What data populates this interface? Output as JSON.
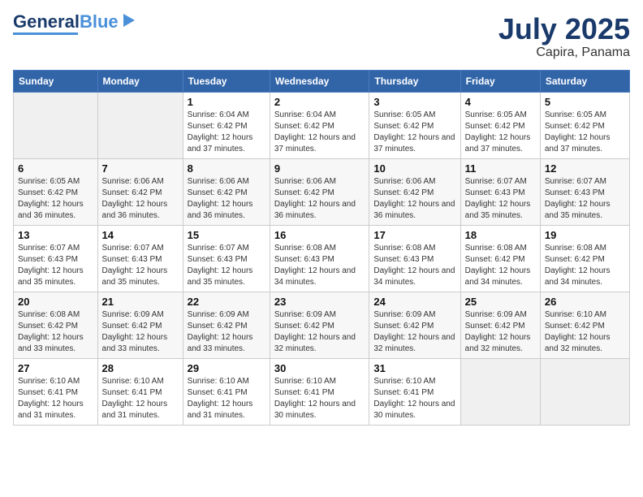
{
  "header": {
    "logo_main": "General",
    "logo_accent": "Blue",
    "month": "July 2025",
    "location": "Capira, Panama"
  },
  "days_of_week": [
    "Sunday",
    "Monday",
    "Tuesday",
    "Wednesday",
    "Thursday",
    "Friday",
    "Saturday"
  ],
  "weeks": [
    [
      {
        "day": "",
        "info": ""
      },
      {
        "day": "",
        "info": ""
      },
      {
        "day": "1",
        "info": "Sunrise: 6:04 AM\nSunset: 6:42 PM\nDaylight: 12 hours and 37 minutes."
      },
      {
        "day": "2",
        "info": "Sunrise: 6:04 AM\nSunset: 6:42 PM\nDaylight: 12 hours and 37 minutes."
      },
      {
        "day": "3",
        "info": "Sunrise: 6:05 AM\nSunset: 6:42 PM\nDaylight: 12 hours and 37 minutes."
      },
      {
        "day": "4",
        "info": "Sunrise: 6:05 AM\nSunset: 6:42 PM\nDaylight: 12 hours and 37 minutes."
      },
      {
        "day": "5",
        "info": "Sunrise: 6:05 AM\nSunset: 6:42 PM\nDaylight: 12 hours and 37 minutes."
      }
    ],
    [
      {
        "day": "6",
        "info": "Sunrise: 6:05 AM\nSunset: 6:42 PM\nDaylight: 12 hours and 36 minutes."
      },
      {
        "day": "7",
        "info": "Sunrise: 6:06 AM\nSunset: 6:42 PM\nDaylight: 12 hours and 36 minutes."
      },
      {
        "day": "8",
        "info": "Sunrise: 6:06 AM\nSunset: 6:42 PM\nDaylight: 12 hours and 36 minutes."
      },
      {
        "day": "9",
        "info": "Sunrise: 6:06 AM\nSunset: 6:42 PM\nDaylight: 12 hours and 36 minutes."
      },
      {
        "day": "10",
        "info": "Sunrise: 6:06 AM\nSunset: 6:42 PM\nDaylight: 12 hours and 36 minutes."
      },
      {
        "day": "11",
        "info": "Sunrise: 6:07 AM\nSunset: 6:43 PM\nDaylight: 12 hours and 35 minutes."
      },
      {
        "day": "12",
        "info": "Sunrise: 6:07 AM\nSunset: 6:43 PM\nDaylight: 12 hours and 35 minutes."
      }
    ],
    [
      {
        "day": "13",
        "info": "Sunrise: 6:07 AM\nSunset: 6:43 PM\nDaylight: 12 hours and 35 minutes."
      },
      {
        "day": "14",
        "info": "Sunrise: 6:07 AM\nSunset: 6:43 PM\nDaylight: 12 hours and 35 minutes."
      },
      {
        "day": "15",
        "info": "Sunrise: 6:07 AM\nSunset: 6:43 PM\nDaylight: 12 hours and 35 minutes."
      },
      {
        "day": "16",
        "info": "Sunrise: 6:08 AM\nSunset: 6:43 PM\nDaylight: 12 hours and 34 minutes."
      },
      {
        "day": "17",
        "info": "Sunrise: 6:08 AM\nSunset: 6:43 PM\nDaylight: 12 hours and 34 minutes."
      },
      {
        "day": "18",
        "info": "Sunrise: 6:08 AM\nSunset: 6:42 PM\nDaylight: 12 hours and 34 minutes."
      },
      {
        "day": "19",
        "info": "Sunrise: 6:08 AM\nSunset: 6:42 PM\nDaylight: 12 hours and 34 minutes."
      }
    ],
    [
      {
        "day": "20",
        "info": "Sunrise: 6:08 AM\nSunset: 6:42 PM\nDaylight: 12 hours and 33 minutes."
      },
      {
        "day": "21",
        "info": "Sunrise: 6:09 AM\nSunset: 6:42 PM\nDaylight: 12 hours and 33 minutes."
      },
      {
        "day": "22",
        "info": "Sunrise: 6:09 AM\nSunset: 6:42 PM\nDaylight: 12 hours and 33 minutes."
      },
      {
        "day": "23",
        "info": "Sunrise: 6:09 AM\nSunset: 6:42 PM\nDaylight: 12 hours and 32 minutes."
      },
      {
        "day": "24",
        "info": "Sunrise: 6:09 AM\nSunset: 6:42 PM\nDaylight: 12 hours and 32 minutes."
      },
      {
        "day": "25",
        "info": "Sunrise: 6:09 AM\nSunset: 6:42 PM\nDaylight: 12 hours and 32 minutes."
      },
      {
        "day": "26",
        "info": "Sunrise: 6:10 AM\nSunset: 6:42 PM\nDaylight: 12 hours and 32 minutes."
      }
    ],
    [
      {
        "day": "27",
        "info": "Sunrise: 6:10 AM\nSunset: 6:41 PM\nDaylight: 12 hours and 31 minutes."
      },
      {
        "day": "28",
        "info": "Sunrise: 6:10 AM\nSunset: 6:41 PM\nDaylight: 12 hours and 31 minutes."
      },
      {
        "day": "29",
        "info": "Sunrise: 6:10 AM\nSunset: 6:41 PM\nDaylight: 12 hours and 31 minutes."
      },
      {
        "day": "30",
        "info": "Sunrise: 6:10 AM\nSunset: 6:41 PM\nDaylight: 12 hours and 30 minutes."
      },
      {
        "day": "31",
        "info": "Sunrise: 6:10 AM\nSunset: 6:41 PM\nDaylight: 12 hours and 30 minutes."
      },
      {
        "day": "",
        "info": ""
      },
      {
        "day": "",
        "info": ""
      }
    ]
  ]
}
